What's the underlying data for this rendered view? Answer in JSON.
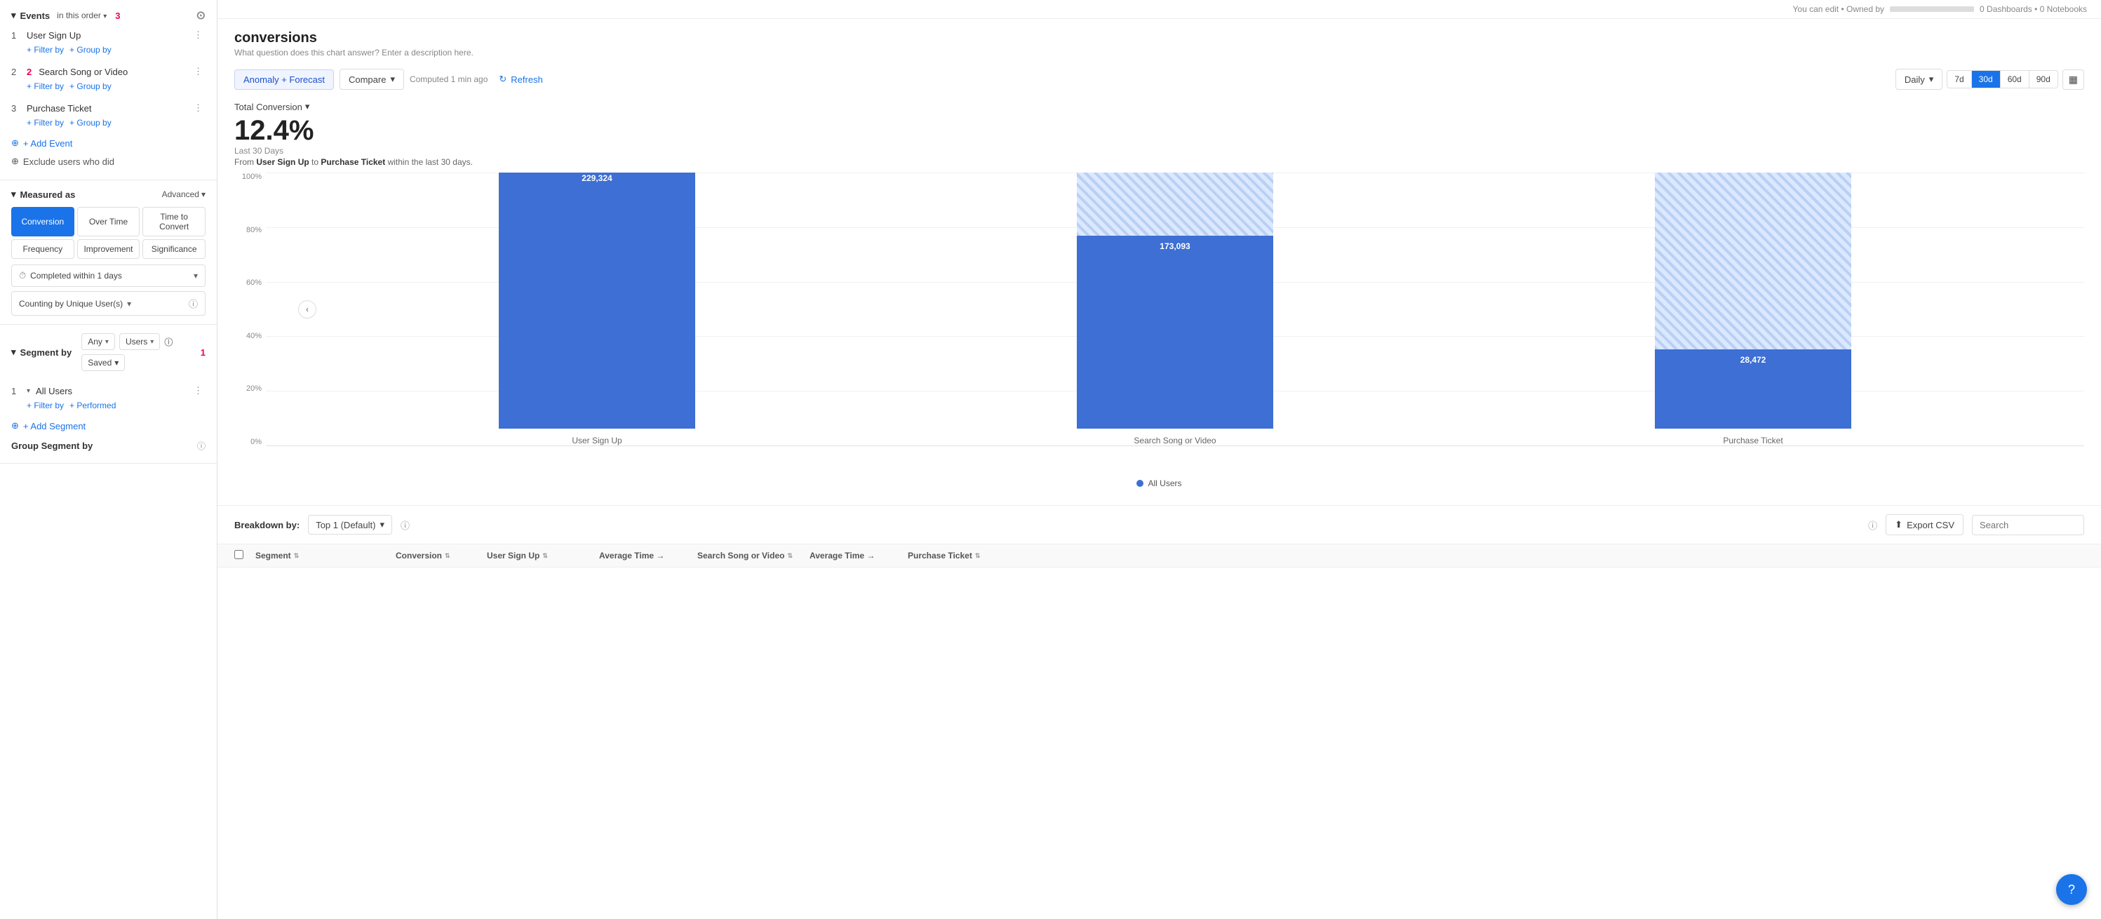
{
  "topbar": {
    "owner_text": "You can edit • Owned by",
    "owner_name": "████████████████",
    "dashboards": "0 Dashboards • 0 Notebooks"
  },
  "sidebar": {
    "events_section": {
      "title": "Events",
      "badge": "3",
      "in_order": "in this order",
      "bookmark_icon": "⊙"
    },
    "events": [
      {
        "num": "1",
        "name": "User Sign Up",
        "filter_label": "+ Filter by",
        "group_label": "+ Group by"
      },
      {
        "num": "2",
        "name": "Search Song or Video",
        "filter_label": "+ Filter by",
        "group_label": "+ Group by"
      },
      {
        "num": "3",
        "name": "Purchase Ticket",
        "filter_label": "+ Filter by",
        "group_label": "+ Group by"
      }
    ],
    "add_event": "+ Add Event",
    "exclude_btn": "Exclude users who did",
    "measured_as": {
      "title": "Measured as",
      "advanced": "Advanced",
      "tabs": [
        "Conversion",
        "Over Time",
        "Time to Convert",
        "Frequency",
        "Improvement",
        "Significance"
      ],
      "active_tab": "Conversion",
      "completed_within": "Completed within 1 days",
      "counting_by": "Counting by Unique User(s)"
    },
    "segment_section": {
      "title": "Segment by",
      "badge": "1",
      "any_label": "Any",
      "users_label": "Users",
      "saved_label": "Saved"
    },
    "segments": [
      {
        "num": "1",
        "name": "All Users",
        "filter_label": "+ Filter by",
        "performed_label": "+ Performed"
      }
    ],
    "add_segment": "+ Add Segment",
    "group_segment": "Group Segment by"
  },
  "toolbar": {
    "anomaly_forecast_label": "Anomaly + Forecast",
    "compare_label": "Compare",
    "computed_text": "Computed 1 min ago",
    "refresh_label": "Refresh",
    "daily_label": "Daily",
    "periods": [
      "7d",
      "30d",
      "60d",
      "90d"
    ],
    "active_period": "30d",
    "cal_icon": "▦"
  },
  "chart": {
    "title": "conversions",
    "subtitle": "What question does this chart answer? Enter a description here.",
    "metric_label": "Total Conversion",
    "metric_value": "12.4%",
    "period_label": "Last 30 Days",
    "desc_from": "User Sign Up",
    "desc_to": "Purchase Ticket",
    "desc_suffix": "within the last 30 days.",
    "y_axis": [
      "100%",
      "80%",
      "60%",
      "40%",
      "20%",
      "0%"
    ],
    "bars": [
      {
        "label": "User Sign Up",
        "value": 229324,
        "value_text": "229,324",
        "height_pct": 100,
        "type": "solid"
      },
      {
        "label": "Search Song or Video",
        "value": 173093,
        "value_text": "173,093",
        "height_pct": 75.5,
        "type": "mixed"
      },
      {
        "label": "Purchase Ticket",
        "value": 28472,
        "value_text": "28,472",
        "height_pct": 31,
        "type": "mixed"
      }
    ],
    "legend": [
      {
        "label": "All Users",
        "color": "#3d6fd4"
      }
    ]
  },
  "breakdown": {
    "label": "Breakdown by:",
    "select_label": "Top 1 (Default)",
    "export_label": "Export CSV",
    "search_placeholder": "Search"
  },
  "table_headers": [
    {
      "label": "Segment"
    },
    {
      "label": "Conversion"
    },
    {
      "label": "User Sign Up"
    },
    {
      "label": "Average Time →"
    },
    {
      "label": "Search Song or Video"
    },
    {
      "label": "Average Time →"
    },
    {
      "label": "Purchase Ticket"
    }
  ]
}
